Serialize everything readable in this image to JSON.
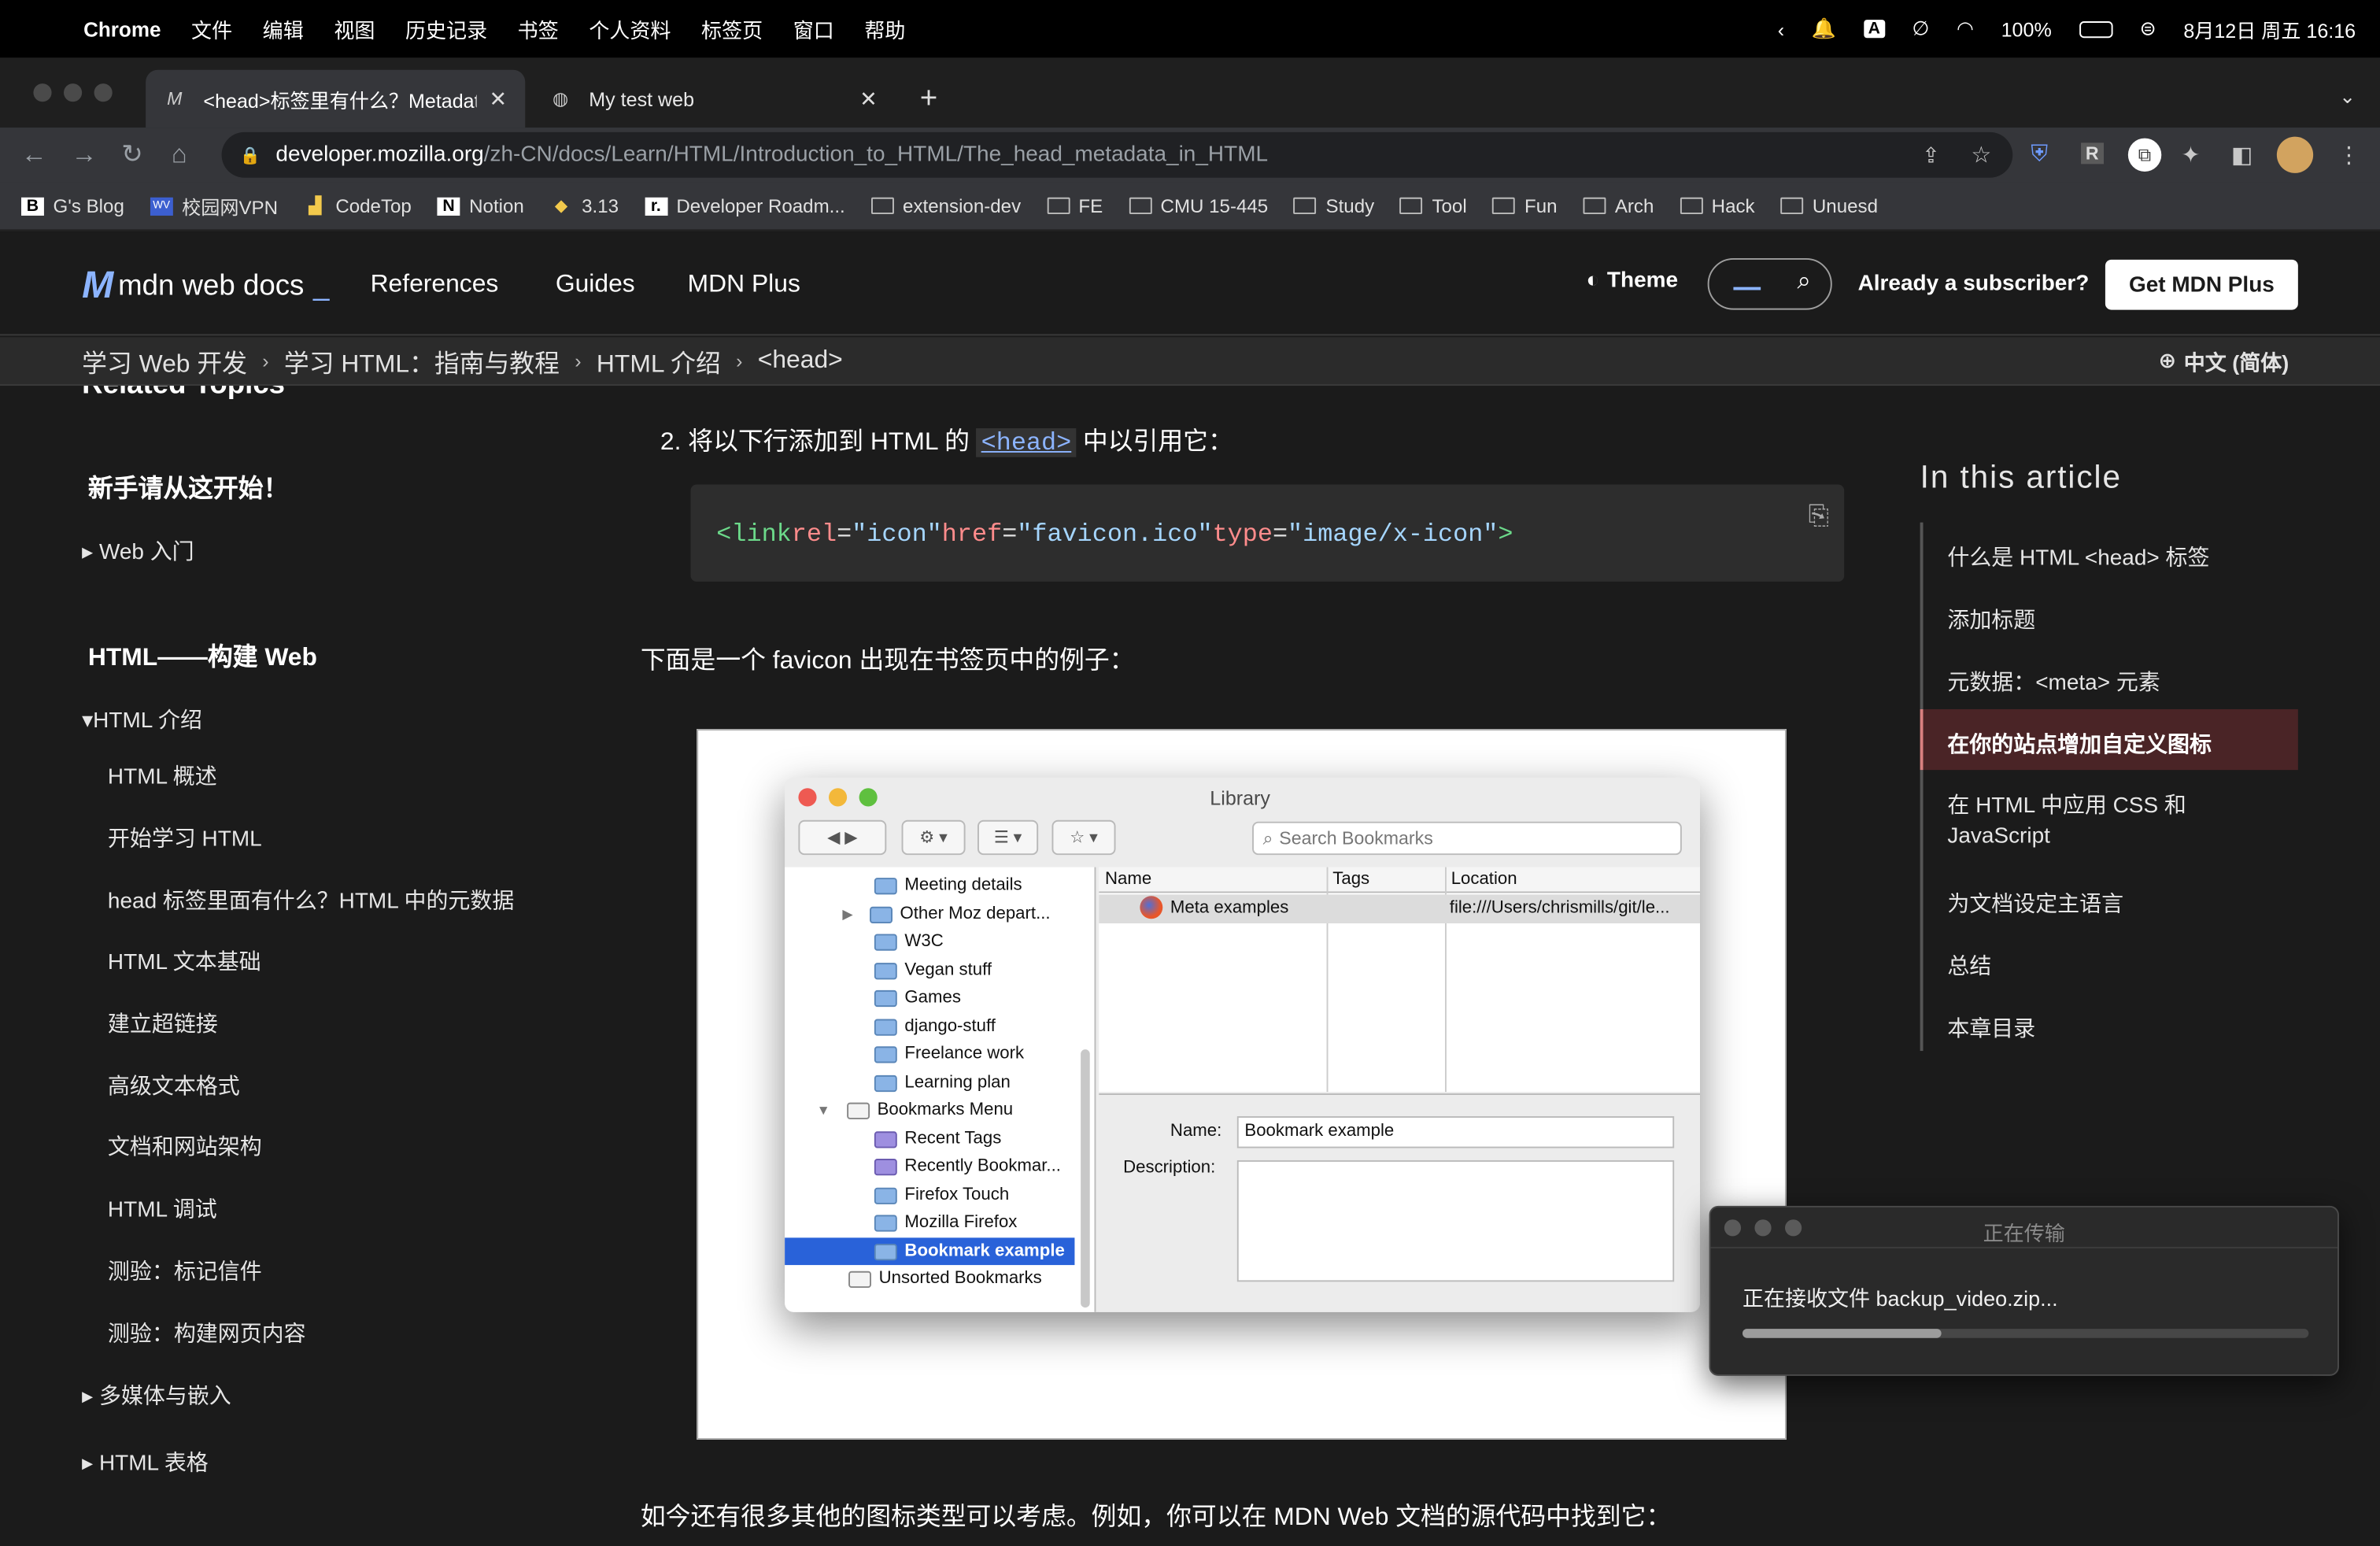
{
  "menubar": {
    "app": "Chrome",
    "items": [
      "文件",
      "编辑",
      "视图",
      "历史记录",
      "书签",
      "个人资料",
      "标签页",
      "窗口",
      "帮助"
    ],
    "battery": "100%",
    "datetime": "8月12日 周五  16:16"
  },
  "tabs": [
    {
      "label": "<head>标签里有什么？Metadat",
      "active": true
    },
    {
      "label": "My test web",
      "active": false
    }
  ],
  "address": {
    "domain": "developer.mozilla.org",
    "path": "/zh-CN/docs/Learn/HTML/Introduction_to_HTML/The_head_metadata_in_HTML"
  },
  "bookmarks": [
    "G's Blog",
    "校园网VPN",
    "CodeTop",
    "Notion",
    "3.13",
    "Developer Roadm...",
    "extension-dev",
    "FE",
    "CMU 15-445",
    "Study",
    "Tool",
    "Fun",
    "Arch",
    "Hack",
    "Unuesd"
  ],
  "mdn": {
    "logo_text": "mdn web docs",
    "nav": [
      "References",
      "Guides",
      "MDN Plus"
    ],
    "theme": "Theme",
    "subscriber": "Already a subscriber?",
    "get_plus": "Get MDN Plus"
  },
  "breadcrumbs": [
    "学习 Web 开发",
    "学习 HTML：指南与教程",
    "HTML 介绍",
    "<head>"
  ],
  "language": "中文 (简体)",
  "sidebar": {
    "related_topics": "Related Topics",
    "start_here": "新手请从这开始！",
    "web_intro": "Web 入门",
    "html_section": "HTML——构建 Web",
    "html_intro": "HTML 介绍",
    "intro_items": [
      "HTML 概述",
      "开始学习 HTML",
      "head 标签里面有什么？HTML 中的元数据",
      "HTML 文本基础",
      "建立超链接",
      "高级文本格式",
      "文档和网站架构",
      "HTML 调试",
      "测验：标记信件",
      "测验：构建网页内容"
    ],
    "multimedia": "多媒体与嵌入",
    "tables": "HTML 表格"
  },
  "content": {
    "step2_prefix": "2. 将以下行添加到 HTML 的 ",
    "step2_code": "<head>",
    "step2_suffix": " 中以引用它：",
    "code": {
      "open": "<link",
      "rel_attr": " rel",
      "rel_val": "\"icon\"",
      "href_attr": " href",
      "href_val": "\"favicon.ico\"",
      "type_attr": " type",
      "type_val": "\"image/x-icon\"",
      "close": ">"
    },
    "favicon_example": "下面是一个 favicon 出现在书签页中的例子：",
    "bottom_text": "如今还有很多其他的图标类型可以考虑。例如，你可以在 MDN Web 文档的源代码中找到它："
  },
  "library_window": {
    "title": "Library",
    "search_placeholder": "Search Bookmarks",
    "folders": [
      "Meeting details",
      "Other Moz depart...",
      "W3C",
      "Vegan stuff",
      "Games",
      "django-stuff",
      "Freelance work",
      "Learning plan",
      "Bookmarks Menu",
      "Recent Tags",
      "Recently Bookmar...",
      "Firefox Touch",
      "Mozilla Firefox",
      "Bookmark example",
      "Unsorted Bookmarks"
    ],
    "columns": [
      "Name",
      "Tags",
      "Location"
    ],
    "row": {
      "name": "Meta examples",
      "location": "file:///Users/chrismills/git/le..."
    },
    "name_label": "Name:",
    "name_value": "Bookmark example",
    "description_label": "Description:"
  },
  "toc": {
    "title": "In this article",
    "items": [
      "什么是 HTML <head> 标签",
      "添加标题",
      "元数据：<meta> 元素",
      "在你的站点增加自定义图标",
      "在 HTML 中应用 CSS 和",
      "JavaScript",
      "为文档设定主语言",
      "总结",
      "本章目录"
    ],
    "active_index": 3
  },
  "notification": {
    "title": "正在传输",
    "message": "正在接收文件 backup_video.zip...",
    "progress": 0.35
  },
  "colors": {
    "accent": "#8cb4ff",
    "toc_active_bg": "#4a2426",
    "code_tag": "#6cd98a",
    "code_attr": "#ff8c8c",
    "code_str": "#a5d6ff"
  }
}
